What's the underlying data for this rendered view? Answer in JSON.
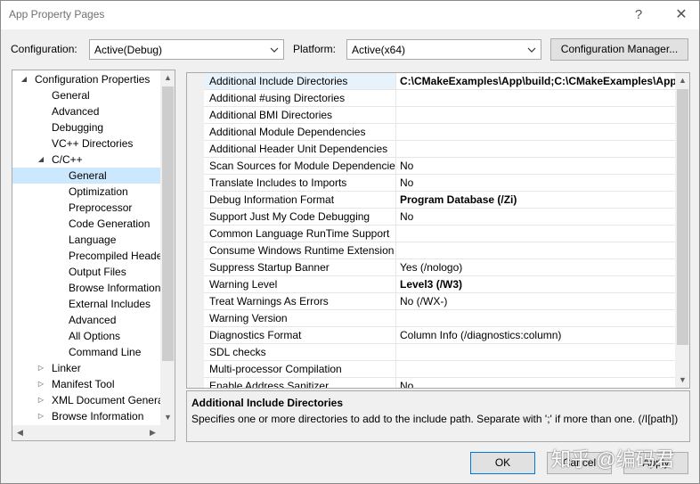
{
  "window": {
    "title": "App Property Pages",
    "help_glyph": "?",
    "close_glyph": "✕"
  },
  "toolbar": {
    "configuration_label": "Configuration:",
    "configuration_value": "Active(Debug)",
    "platform_label": "Platform:",
    "platform_value": "Active(x64)",
    "config_manager_label": "Configuration Manager..."
  },
  "tree": {
    "items": [
      {
        "label": "Configuration Properties",
        "level": 0,
        "expander": "◢"
      },
      {
        "label": "General",
        "level": 1,
        "expander": ""
      },
      {
        "label": "Advanced",
        "level": 1,
        "expander": ""
      },
      {
        "label": "Debugging",
        "level": 1,
        "expander": ""
      },
      {
        "label": "VC++ Directories",
        "level": 1,
        "expander": ""
      },
      {
        "label": "C/C++",
        "level": 1,
        "expander": "◢"
      },
      {
        "label": "General",
        "level": 2,
        "expander": "",
        "selected": true
      },
      {
        "label": "Optimization",
        "level": 2,
        "expander": ""
      },
      {
        "label": "Preprocessor",
        "level": 2,
        "expander": ""
      },
      {
        "label": "Code Generation",
        "level": 2,
        "expander": ""
      },
      {
        "label": "Language",
        "level": 2,
        "expander": ""
      },
      {
        "label": "Precompiled Heade",
        "level": 2,
        "expander": ""
      },
      {
        "label": "Output Files",
        "level": 2,
        "expander": ""
      },
      {
        "label": "Browse Information",
        "level": 2,
        "expander": ""
      },
      {
        "label": "External Includes",
        "level": 2,
        "expander": ""
      },
      {
        "label": "Advanced",
        "level": 2,
        "expander": ""
      },
      {
        "label": "All Options",
        "level": 2,
        "expander": ""
      },
      {
        "label": "Command Line",
        "level": 2,
        "expander": ""
      },
      {
        "label": "Linker",
        "level": 1,
        "expander": "▷"
      },
      {
        "label": "Manifest Tool",
        "level": 1,
        "expander": "▷"
      },
      {
        "label": "XML Document Genera",
        "level": 1,
        "expander": "▷"
      },
      {
        "label": "Browse Information",
        "level": 1,
        "expander": "▷"
      }
    ]
  },
  "grid": {
    "rows": [
      {
        "name": "Additional Include Directories",
        "value": "C:\\CMakeExamples\\App\\build;C:\\CMakeExamples\\App\\s",
        "bold": true,
        "selected": true
      },
      {
        "name": "Additional #using Directories",
        "value": "",
        "bold": false
      },
      {
        "name": "Additional BMI Directories",
        "value": "",
        "bold": false
      },
      {
        "name": "Additional Module Dependencies",
        "value": "",
        "bold": false
      },
      {
        "name": "Additional Header Unit Dependencies",
        "value": "",
        "bold": false
      },
      {
        "name": "Scan Sources for Module Dependencies",
        "value": "No",
        "bold": false
      },
      {
        "name": "Translate Includes to Imports",
        "value": "No",
        "bold": false
      },
      {
        "name": "Debug Information Format",
        "value": "Program Database (/Zi)",
        "bold": true
      },
      {
        "name": "Support Just My Code Debugging",
        "value": "No",
        "bold": false
      },
      {
        "name": "Common Language RunTime Support",
        "value": "",
        "bold": false
      },
      {
        "name": "Consume Windows Runtime Extension",
        "value": "",
        "bold": false
      },
      {
        "name": "Suppress Startup Banner",
        "value": "Yes (/nologo)",
        "bold": false
      },
      {
        "name": "Warning Level",
        "value": "Level3 (/W3)",
        "bold": true
      },
      {
        "name": "Treat Warnings As Errors",
        "value": "No (/WX-)",
        "bold": false
      },
      {
        "name": "Warning Version",
        "value": "",
        "bold": false
      },
      {
        "name": "Diagnostics Format",
        "value": "Column Info (/diagnostics:column)",
        "bold": false
      },
      {
        "name": "SDL checks",
        "value": "",
        "bold": false
      },
      {
        "name": "Multi-processor Compilation",
        "value": "",
        "bold": false
      },
      {
        "name": "Enable Address Sanitizer",
        "value": "No",
        "bold": false
      }
    ]
  },
  "description": {
    "title": "Additional Include Directories",
    "body": "Specifies one or more directories to add to the include path. Separate with ';' if more than one. (/I[path])"
  },
  "buttons": {
    "ok": "OK",
    "cancel": "Cancel",
    "apply": "Apply"
  },
  "watermark": "知乎 @编码君",
  "icons": {
    "dropdown": "chevron-down-icon",
    "scroll_up": "▲",
    "scroll_down": "▼",
    "scroll_left": "◀",
    "scroll_right": "▶"
  }
}
